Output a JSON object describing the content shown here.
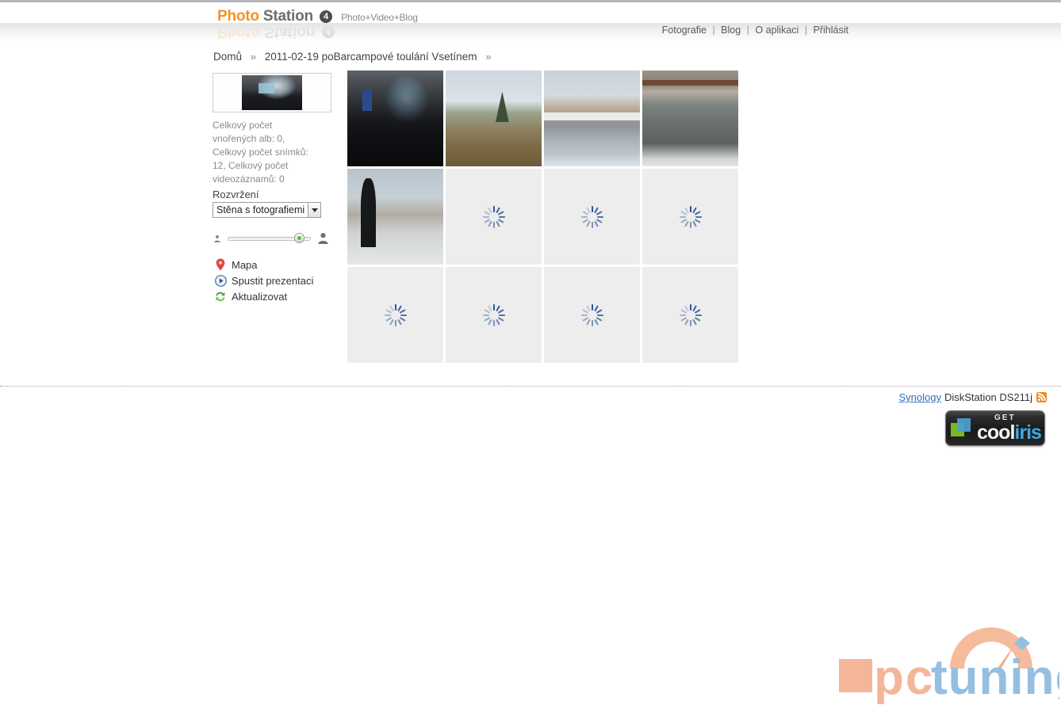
{
  "header": {
    "logo_primary": "Photo",
    "logo_secondary": "Station",
    "logo_version": "4",
    "logo_tagline": "Photo+Video+Blog",
    "nav": [
      {
        "label": "Fotografie"
      },
      {
        "label": "Blog"
      },
      {
        "label": "O aplikaci"
      },
      {
        "label": "Přihlásit"
      }
    ],
    "nav_separator": "|"
  },
  "breadcrumb": {
    "items": [
      {
        "label": "Domů"
      },
      {
        "label": "2011-02-19 poBarcampové toulání Vsetínem"
      }
    ],
    "chevron": "»"
  },
  "sidebar": {
    "cover_alt": "album-cover-thumbnail",
    "stats": "Celkový počet vnořených alb: 0, Celkový počet snímků: 12, Celkový počet videozáznamů: 0",
    "layout_label": "Rozvržení",
    "layout_selected": "Stěna s fotografiemi",
    "layout_options": [
      "Stěna s fotografiemi"
    ],
    "slider": {
      "min_icon": "small-person-icon",
      "max_icon": "large-person-icon",
      "value_percent": 80
    },
    "actions": [
      {
        "label": "Mapa",
        "icon": "map-pin-icon"
      },
      {
        "label": "Spustit prezentaci",
        "icon": "play-circle-icon"
      },
      {
        "label": "Aktualizovat",
        "icon": "refresh-icon"
      }
    ]
  },
  "grid": {
    "tiles": [
      {
        "state": "loaded",
        "style": "photo-a",
        "alt": "conference-room-presentation"
      },
      {
        "state": "loaded",
        "style": "photo-b",
        "alt": "village-houses-winter"
      },
      {
        "state": "loaded",
        "style": "photo-c",
        "alt": "river-bridge-mansion"
      },
      {
        "state": "loaded",
        "style": "photo-d",
        "alt": "stone-bridge-frozen-river"
      },
      {
        "state": "loaded",
        "style": "photo-e",
        "alt": "black-statue-winter"
      },
      {
        "state": "loading",
        "style": "",
        "alt": "loading-thumbnail"
      },
      {
        "state": "loading",
        "style": "",
        "alt": "loading-thumbnail"
      },
      {
        "state": "loading",
        "style": "",
        "alt": "loading-thumbnail"
      },
      {
        "state": "loading",
        "style": "",
        "alt": "loading-thumbnail"
      },
      {
        "state": "loading",
        "style": "",
        "alt": "loading-thumbnail"
      },
      {
        "state": "loading",
        "style": "",
        "alt": "loading-thumbnail"
      },
      {
        "state": "loading",
        "style": "",
        "alt": "loading-thumbnail"
      }
    ]
  },
  "footer": {
    "brand_link": "Synology",
    "brand_model": "DiskStation DS211j",
    "rss_icon": "rss-feed-icon",
    "cooliris": {
      "get": "GET",
      "cool": "cool",
      "iris": "iris"
    }
  },
  "watermark": {
    "pc": "pc",
    "tuning": "tuning"
  },
  "colors": {
    "accent_orange": "#f39324",
    "link_blue": "#2f6fc4",
    "tile_bg": "#ededed",
    "spinner_blue": "#2e5493",
    "watermark_salmon": "#f4b393",
    "watermark_blue": "#8fbce0"
  }
}
